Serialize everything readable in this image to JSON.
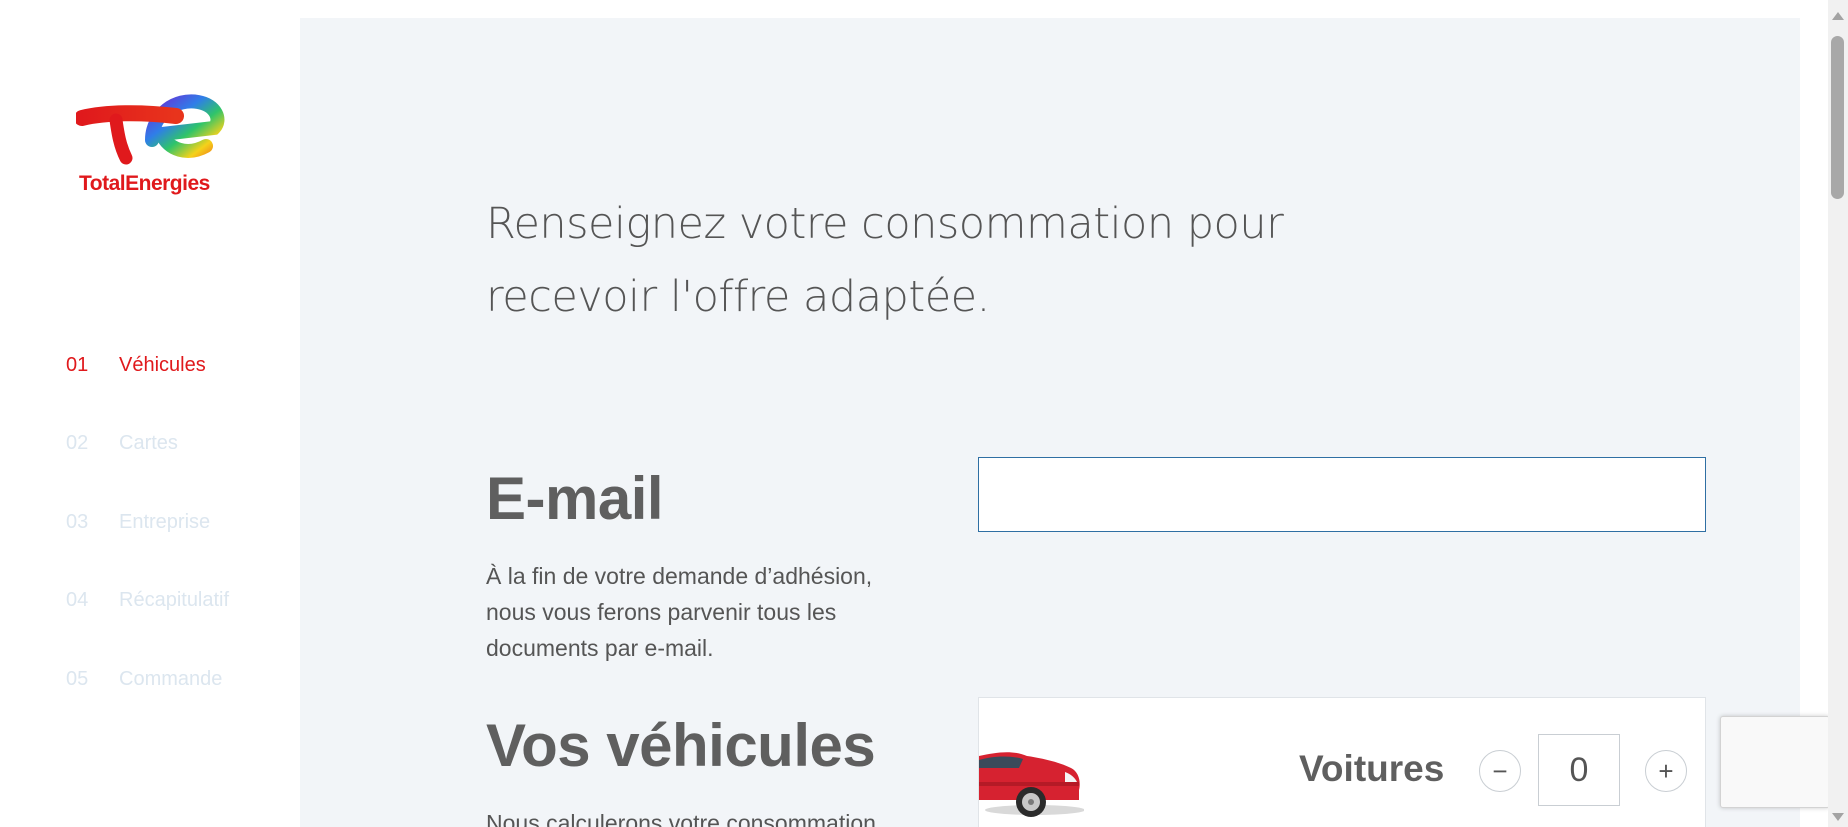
{
  "brand": {
    "logo_text": "TotalEnergies",
    "accent_color": "#e0191c"
  },
  "steps": [
    {
      "num": "01",
      "label": "Véhicules",
      "state": "active"
    },
    {
      "num": "02",
      "label": "Cartes",
      "state": "inactive"
    },
    {
      "num": "03",
      "label": "Entreprise",
      "state": "inactive"
    },
    {
      "num": "04",
      "label": "Récapitulatif",
      "state": "inactive"
    },
    {
      "num": "05",
      "label": "Commande",
      "state": "inactive"
    }
  ],
  "main": {
    "headline_line1": "Renseignez votre consommation pour",
    "headline_line2": "recevoir l'offre adaptée.",
    "email": {
      "title": "E-mail",
      "description": "À la fin de votre demande d’adhésion, nous vous ferons parvenir tous les documents par e-mail.",
      "value": "",
      "placeholder": ""
    },
    "vehicles": {
      "title": "Vos véhicules",
      "description": "Nous calculerons votre consommation",
      "items": [
        {
          "label": "Voitures",
          "quantity": "0",
          "minus_symbol": "−",
          "plus_symbol": "+",
          "icon": "car-icon"
        }
      ]
    }
  }
}
